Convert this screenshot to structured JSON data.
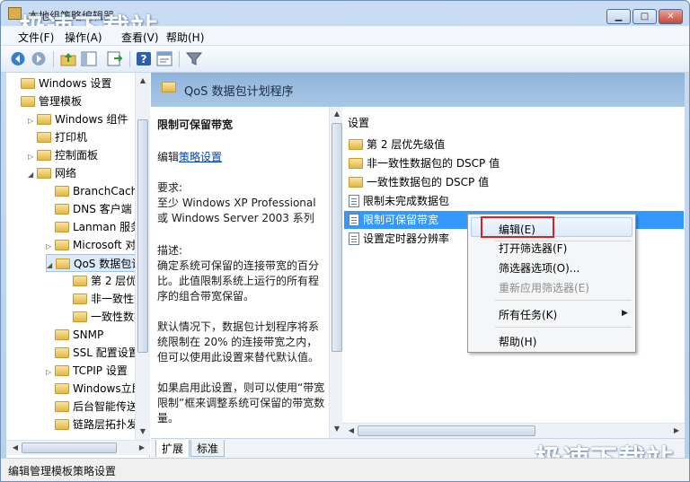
{
  "window": {
    "title": "本地组策略编辑器",
    "watermark_top": "极速下载站",
    "watermark_bottom": "极速下载站"
  },
  "menu": [
    "文件(F)",
    "操作(A)",
    "查看(V)",
    "帮助(H)"
  ],
  "toolbar_icons": [
    "back-icon",
    "forward-icon",
    "up-folder-icon",
    "show-tree-icon",
    "export-icon",
    "help-icon",
    "properties-icon",
    "filter-icon"
  ],
  "tree": {
    "items": [
      {
        "label": "Windows 设置",
        "indent": 0,
        "twisty": ""
      },
      {
        "label": "管理模板",
        "indent": 0,
        "twisty": ""
      },
      {
        "label": "Windows 组件",
        "indent": 1,
        "twisty": "▷"
      },
      {
        "label": "打印机",
        "indent": 1,
        "twisty": ""
      },
      {
        "label": "控制面板",
        "indent": 1,
        "twisty": "▷"
      },
      {
        "label": "网络",
        "indent": 1,
        "twisty": "◢"
      },
      {
        "label": "BranchCache",
        "indent": 2,
        "twisty": ""
      },
      {
        "label": "DNS 客户端",
        "indent": 2,
        "twisty": ""
      },
      {
        "label": "Lanman 服务",
        "indent": 2,
        "twisty": ""
      },
      {
        "label": "Microsoft 对",
        "indent": 2,
        "twisty": "▷"
      },
      {
        "label": "QoS 数据包计",
        "indent": 2,
        "twisty": "◢",
        "selected": true
      },
      {
        "label": "第 2 层优先",
        "indent": 3,
        "twisty": ""
      },
      {
        "label": "非一致性数",
        "indent": 3,
        "twisty": ""
      },
      {
        "label": "一致性数据",
        "indent": 3,
        "twisty": ""
      },
      {
        "label": "SNMP",
        "indent": 2,
        "twisty": ""
      },
      {
        "label": "SSL 配置设置",
        "indent": 2,
        "twisty": ""
      },
      {
        "label": "TCPIP 设置",
        "indent": 2,
        "twisty": "▷"
      },
      {
        "label": "Windows立即",
        "indent": 2,
        "twisty": ""
      },
      {
        "label": "后台智能传送",
        "indent": 2,
        "twisty": ""
      },
      {
        "label": "链路层拓扑发",
        "indent": 2,
        "twisty": ""
      }
    ]
  },
  "header": {
    "title": "QoS 数据包计划程序"
  },
  "description": {
    "policy_title": "限制可保留带宽",
    "edit_prefix": "编辑",
    "edit_link": "策略设置",
    "requirements_label": "要求:",
    "requirements_text": "至少 Windows XP Professional 或 Windows Server 2003 系列",
    "desc_label": "描述:",
    "desc_text": "确定系统可保留的连接带宽的百分比。此值限制系统上运行的所有程序的组合带宽保留。",
    "default_text": "默认情况下，数据包计划程序将系统限制在 20% 的连接带宽之内，但可以使用此设置来替代默认值。",
    "enable_text": "如果启用此设置，则可以使用“带宽限制”框来调整系统可保留的带宽数量。"
  },
  "list": {
    "column": "设置",
    "rows": [
      {
        "label": "第 2 层优先级值",
        "type": "folder"
      },
      {
        "label": "非一致性数据包的 DSCP 值",
        "type": "folder"
      },
      {
        "label": "一致性数据包的 DSCP 值",
        "type": "folder"
      },
      {
        "label": "限制未完成数据包",
        "type": "policy"
      },
      {
        "label": "限制可保留带宽",
        "type": "policy",
        "selected": true
      },
      {
        "label": "设置定时器分辨率",
        "type": "policy"
      }
    ]
  },
  "tabs": [
    "扩展",
    "标准"
  ],
  "context_menu": {
    "edit": "编辑(E)",
    "open_filter": "打开筛选器(F)",
    "filter_options": "筛选器选项(O)...",
    "reapply_filter": "重新应用筛选器(E)",
    "all_tasks": "所有任务(K)",
    "help": "帮助(H)"
  },
  "status": "编辑管理模板策略设置"
}
